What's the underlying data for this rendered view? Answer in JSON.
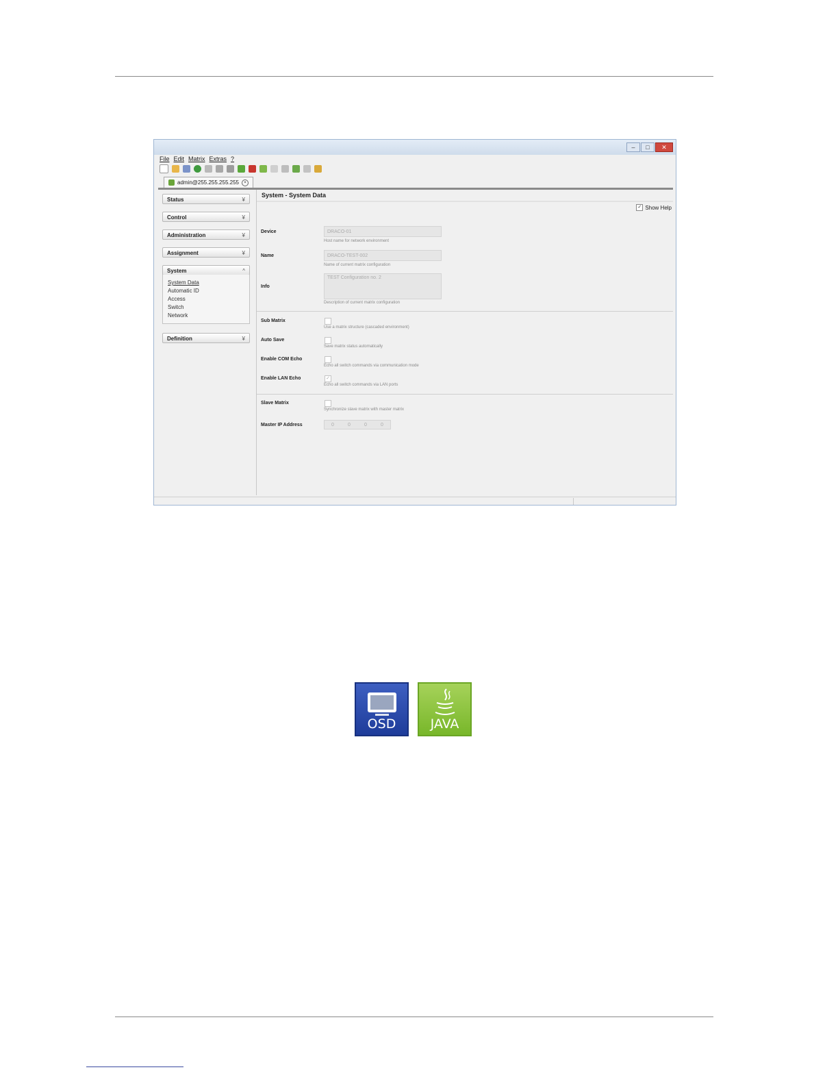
{
  "window": {
    "menu": [
      "File",
      "Edit",
      "Matrix",
      "Extras",
      "?"
    ],
    "tab_label": "admin@255.255.255.255"
  },
  "sidebar": {
    "groups": [
      {
        "label": "Status"
      },
      {
        "label": "Control"
      },
      {
        "label": "Administration"
      },
      {
        "label": "Assignment"
      },
      {
        "label": "System"
      },
      {
        "label": "Definition"
      }
    ],
    "system_items": [
      "System Data",
      "Automatic ID",
      "Access",
      "Switch",
      "Network"
    ]
  },
  "main": {
    "title": "System - System Data",
    "show_help_label": "Show Help",
    "fields": {
      "device": {
        "label": "Device",
        "value": "DRACO-01",
        "help": "Host name for network environment"
      },
      "name": {
        "label": "Name",
        "value": "DRACO-TEST-002",
        "help": "Name of current matrix configuration"
      },
      "info": {
        "label": "Info",
        "value": "TEST Configuration no. 2",
        "help": "Description of current matrix configuration"
      },
      "sub_matrix": {
        "label": "Sub Matrix",
        "help": "Use a matrix structure (cascaded environment)"
      },
      "auto_save": {
        "label": "Auto Save",
        "help": "Save matrix status automatically"
      },
      "enable_com_echo": {
        "label": "Enable COM Echo",
        "help": "Echo all switch commands via communication mode"
      },
      "enable_lan_echo": {
        "label": "Enable LAN Echo",
        "help": "Echo all switch commands via LAN ports"
      },
      "slave_matrix": {
        "label": "Slave Matrix",
        "help": "Synchronize slave matrix with master matrix"
      },
      "master_ip": {
        "label": "Master IP Address",
        "octets": [
          "0",
          "0",
          "0",
          "0"
        ]
      }
    }
  },
  "badges": {
    "osd_label": "OSD",
    "java_label": "JAVA"
  },
  "colors": {
    "osd_blue": "#2a4bb0",
    "java_green": "#8bc53f"
  }
}
